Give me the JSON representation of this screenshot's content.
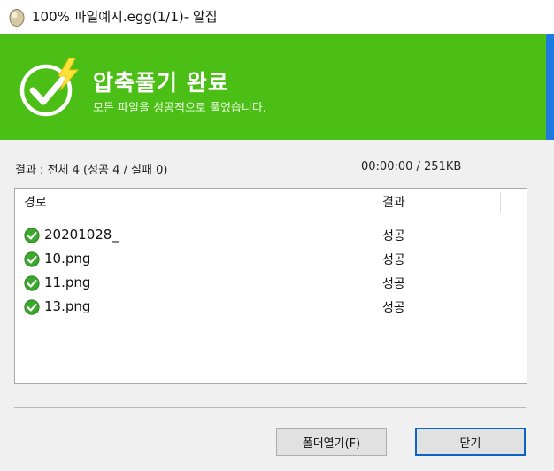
{
  "window": {
    "title": "100% 파일예시.egg(1/1)- 알집"
  },
  "banner": {
    "title": "압축풀기 완료",
    "subtitle": "모든 파일을 성공적으로 풀었습니다.",
    "bg_color": "#4cbf17",
    "accent_color": "#1f7ae0"
  },
  "summary": {
    "result_text": "결과 : 전체 4 (성공 4 / 실패 0)",
    "time_size": "00:00:00 / 251KB"
  },
  "list": {
    "columns": {
      "path": "경로",
      "result": "결과"
    },
    "rows": [
      {
        "name": "20201028_",
        "result": "성공",
        "icon": "success-check-icon"
      },
      {
        "name": "10.png",
        "result": "성공",
        "icon": "success-check-icon"
      },
      {
        "name": "11.png",
        "result": "성공",
        "icon": "success-check-icon"
      },
      {
        "name": "13.png",
        "result": "성공",
        "icon": "success-check-icon"
      }
    ]
  },
  "buttons": {
    "open_folder": "폴더열기(F)",
    "close": "닫기"
  }
}
